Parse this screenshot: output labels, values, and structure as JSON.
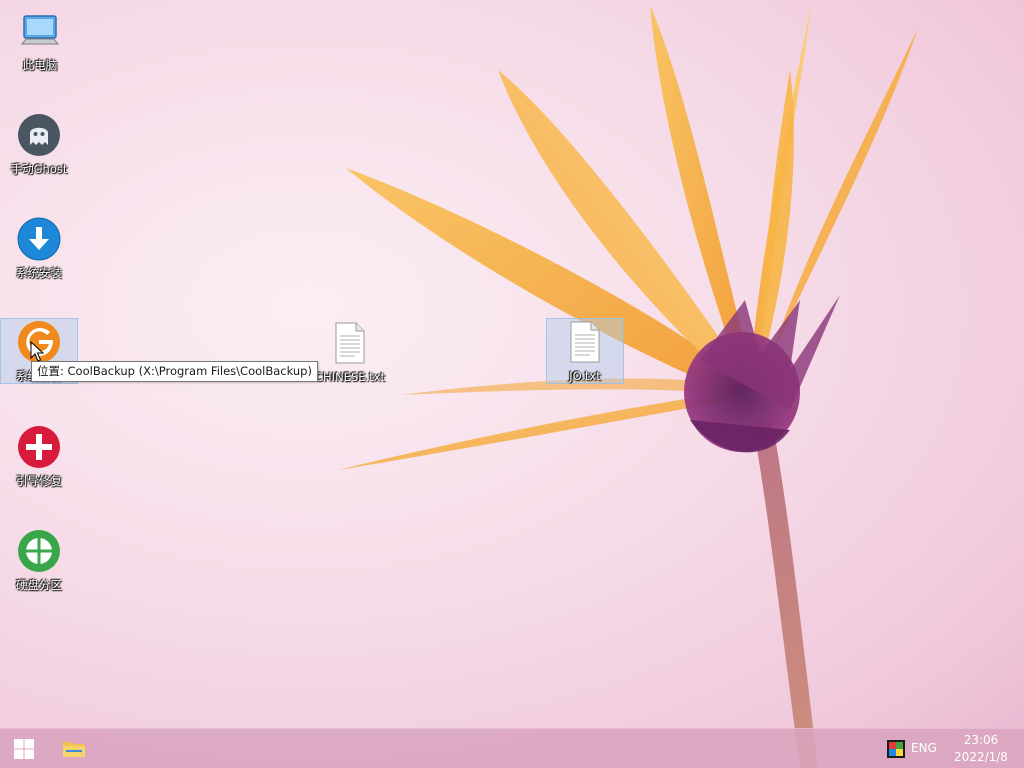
{
  "desktop": {
    "icons": [
      {
        "label": "此电脑"
      },
      {
        "label": "手动Ghost"
      },
      {
        "label": "系统安装"
      },
      {
        "label": "系统备份"
      },
      {
        "label": "引导修复"
      },
      {
        "label": "硬盘分区"
      },
      {
        "label": "CHINESE.txt"
      },
      {
        "label": "JO.txt"
      }
    ],
    "tooltip": "位置: CoolBackup (X:\\Program Files\\CoolBackup)"
  },
  "taskbar": {
    "language": "ENG",
    "time": "23:06",
    "date": "2022/1/8"
  },
  "colors": {
    "taskbar": "#daa4be",
    "petal": "#f4a93a",
    "flower_center": "#7a2a6e",
    "ghost_icon": "#4a5562",
    "install_icon": "#1e88d8",
    "backup_icon": "#f08a1c",
    "repair_icon": "#d81b3c",
    "partition_icon": "#3aa64a"
  }
}
